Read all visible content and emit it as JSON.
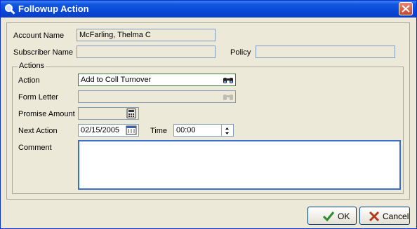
{
  "window": {
    "title": "Followup Action",
    "app_icon": "magnifier-icon",
    "close_icon": "close-icon"
  },
  "fields": {
    "account_name": {
      "label": "Account Name",
      "value": "McFarling, Thelma C"
    },
    "subscriber_name": {
      "label": "Subscriber Name",
      "value": ""
    },
    "policy": {
      "label": "Policy",
      "value": ""
    }
  },
  "actions": {
    "group_title": "Actions",
    "action": {
      "label": "Action",
      "value": "Add to Coll Turnover",
      "icon": "binoculars-icon"
    },
    "form_letter": {
      "label": "Form Letter",
      "value": "",
      "icon": "binoculars-icon"
    },
    "promise_amount": {
      "label": "Promise Amount",
      "value": "",
      "icon": "calculator-icon"
    },
    "next_action": {
      "label": "Next Action",
      "value": "02/15/2005",
      "icon": "calendar-icon"
    },
    "time": {
      "label": "Time",
      "value": "00:00"
    },
    "comment": {
      "label": "Comment",
      "value": ""
    }
  },
  "buttons": {
    "ok": {
      "label": "OK",
      "icon": "checkmark-icon",
      "color": "#2e8b2e"
    },
    "cancel": {
      "label": "Cancel",
      "icon": "x-icon",
      "color": "#b5391c"
    }
  },
  "colors": {
    "title_bar": "#0a48d8",
    "background": "#ece9d8",
    "active_border": "#3c7a3c",
    "comment_border": "#3b6fcf"
  }
}
